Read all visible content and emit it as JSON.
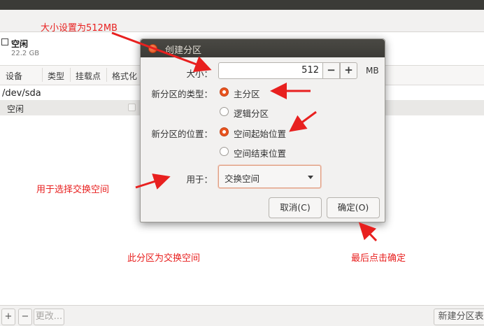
{
  "disk": {
    "name": "空闲",
    "size": "22.2 GB"
  },
  "table": {
    "headers": [
      "设备",
      "类型",
      "挂载点",
      "格式化"
    ],
    "device": "/dev/sda",
    "free_row_label": "空闲"
  },
  "bottom": {
    "add": "+",
    "remove": "−",
    "change": "更改...",
    "new_table": "新建分区表"
  },
  "dialog": {
    "title": "创建分区",
    "size_label": "大小：",
    "size_value": "512",
    "size_unit": "MB",
    "minus": "−",
    "plus": "+",
    "type_label": "新分区的类型：",
    "type_primary": "主分区",
    "type_logical": "逻辑分区",
    "location_label": "新分区的位置：",
    "location_start": "空间起始位置",
    "location_end": "空间结束位置",
    "use_label": "用于：",
    "use_value": "交换空间",
    "cancel": "取消(C)",
    "ok": "确定(O)",
    "selected_type": "主分区",
    "selected_location": "空间起始位置"
  },
  "annotations": {
    "size": "大小设置为512MB",
    "use": "用于选择交换空间",
    "partition": "此分区为交换空间",
    "confirm": "最后点击确定"
  },
  "colors": {
    "accent": "#e95420",
    "annotation": "#e8201f",
    "titlebar": "#3c3b37"
  }
}
